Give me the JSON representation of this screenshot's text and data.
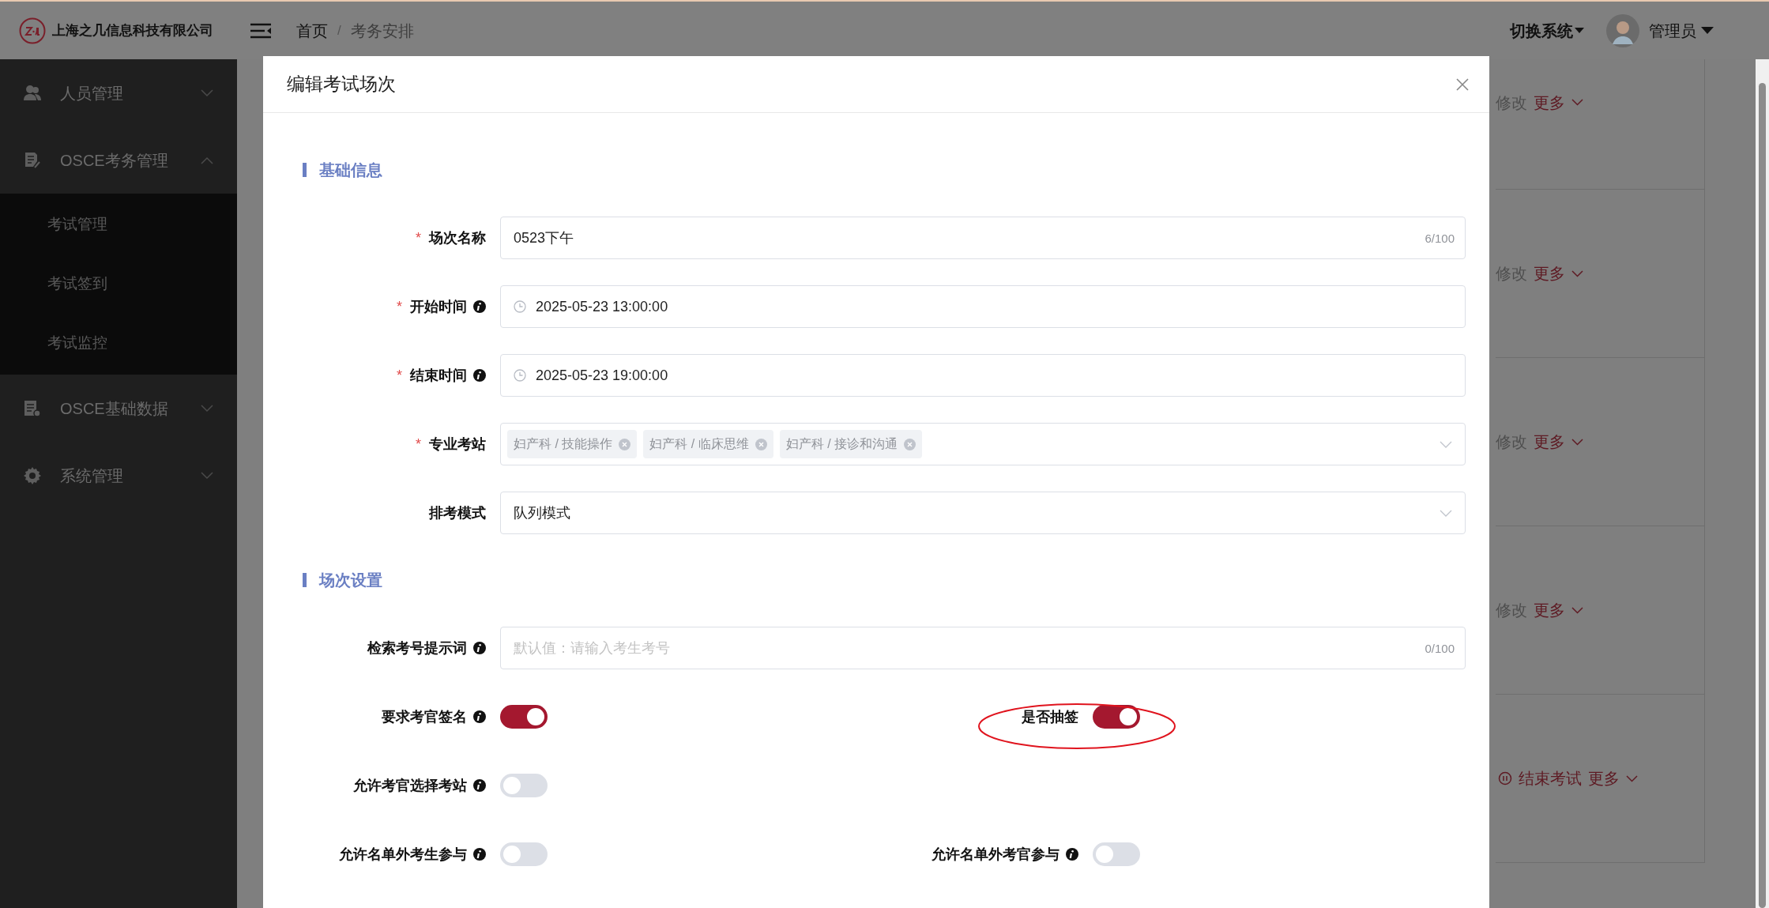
{
  "header": {
    "company": "上海之几信息科技有限公司",
    "breadcrumb": [
      {
        "label": "首页",
        "current": false
      },
      {
        "label": "考务安排",
        "current": true
      }
    ],
    "breadcrumb_separator": "/",
    "switch_system": "切换系统",
    "user": "管理员"
  },
  "sidebar": {
    "items": [
      {
        "label": "人员管理",
        "kind": "people",
        "expanded": false
      },
      {
        "label": "OSCE考务管理",
        "kind": "document",
        "expanded": true,
        "children": [
          {
            "label": "考试管理"
          },
          {
            "label": "考试签到"
          },
          {
            "label": "考试监控"
          }
        ]
      },
      {
        "label": "OSCE基础数据",
        "kind": "data",
        "expanded": false
      },
      {
        "label": "系统管理",
        "kind": "gear",
        "expanded": false
      }
    ]
  },
  "background_rows": [
    {
      "kind": "edit",
      "action": "修改",
      "more": "更多"
    },
    {
      "kind": "edit",
      "action": "修改",
      "more": "更多"
    },
    {
      "kind": "edit",
      "action": "修改",
      "more": "更多"
    },
    {
      "kind": "edit",
      "action": "修改",
      "more": "更多"
    },
    {
      "kind": "stop",
      "action": "结束考试",
      "more": "更多"
    }
  ],
  "modal": {
    "title": "编辑考试场次",
    "sections": [
      {
        "title": "基础信息",
        "fields": [
          {
            "kind": "text",
            "label": "场次名称",
            "asterisk": "*",
            "info": false,
            "value": "0523下午",
            "counter": "6/100"
          },
          {
            "kind": "datetime",
            "label": "开始时间",
            "asterisk": "*",
            "info": true,
            "value": "2025-05-23 13:00:00"
          },
          {
            "kind": "datetime",
            "label": "结束时间",
            "asterisk": "*",
            "info": true,
            "value": "2025-05-23 19:00:00"
          },
          {
            "kind": "tags",
            "label": "专业考站",
            "asterisk": "*",
            "info": false,
            "tags": [
              "妇产科 / 技能操作",
              "妇产科 / 临床思维",
              "妇产科 / 接诊和沟通"
            ]
          },
          {
            "kind": "select",
            "label": "排考模式",
            "info": false,
            "value": "队列模式"
          }
        ]
      },
      {
        "title": "场次设置",
        "fields": [
          {
            "kind": "text",
            "label": "检索考号提示词",
            "info": true,
            "placeholder": "默认值：请输入考生考号",
            "counter": "0/100"
          }
        ],
        "toggle_rows": [
          {
            "items": [
              {
                "label": "要求考官签名",
                "info": true,
                "on": true,
                "circled": false
              },
              {
                "label": "是否抽签",
                "info": false,
                "on": true,
                "circled": true
              }
            ]
          },
          {
            "items": [
              {
                "label": "允许考官选择考站",
                "info": true,
                "on": false,
                "circled": false
              }
            ]
          },
          {
            "items": [
              {
                "label": "允许名单外考生参与",
                "info": true,
                "on": false,
                "circled": false
              },
              {
                "label": "允许名单外考官参与",
                "info": true,
                "on": false,
                "circled": false
              }
            ]
          }
        ]
      }
    ]
  }
}
